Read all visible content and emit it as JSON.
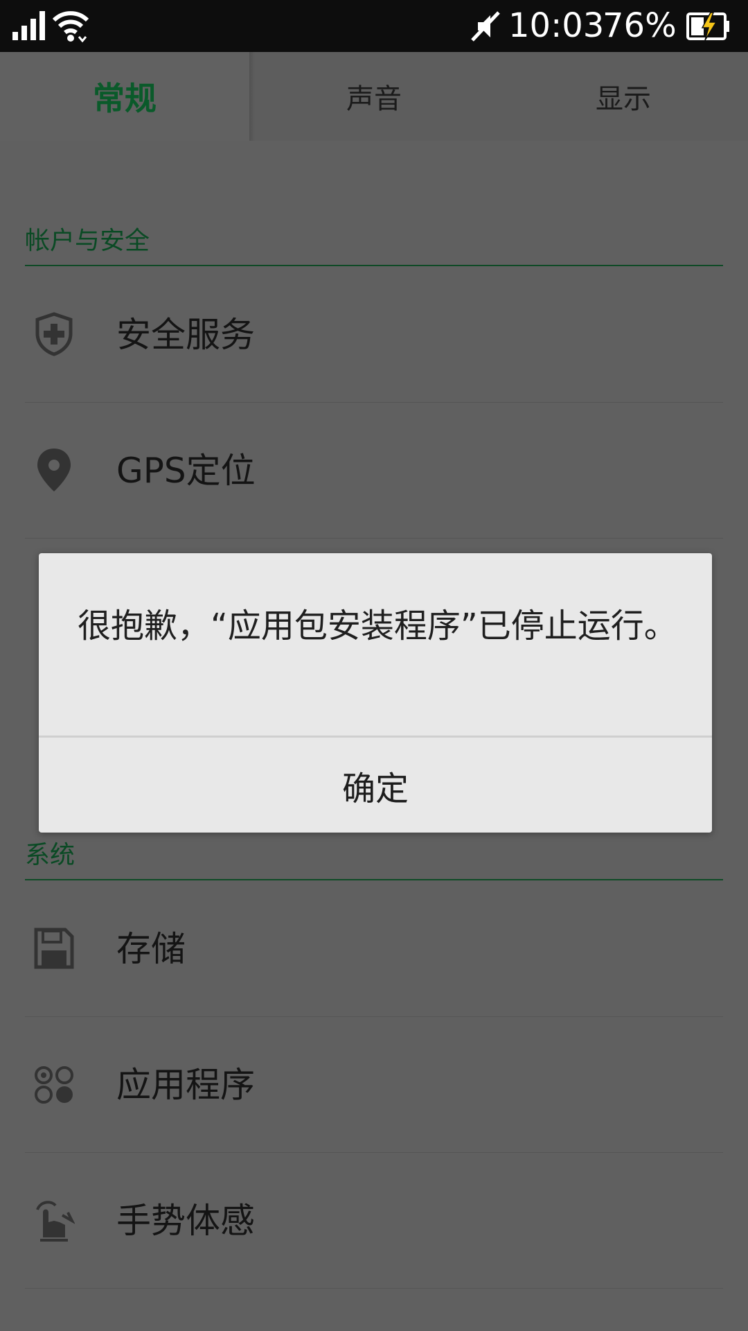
{
  "status_bar": {
    "time": "10:03",
    "battery_percent": "76%",
    "icons": [
      "signal-icon",
      "wifi-icon",
      "mute-icon",
      "battery-charging-icon"
    ],
    "accent_bolt_color": "#f5c518"
  },
  "tabs": [
    {
      "label": "常规",
      "active": true
    },
    {
      "label": "声音",
      "active": false
    },
    {
      "label": "显示",
      "active": false
    }
  ],
  "sections": {
    "account": {
      "title": "帐户与安全",
      "items": [
        {
          "label": "安全服务",
          "icon": "shield-plus-icon"
        },
        {
          "label": "GPS定位",
          "icon": "location-pin-icon"
        }
      ]
    },
    "system": {
      "title": "系统",
      "items": [
        {
          "label": "存储",
          "icon": "floppy-disk-icon"
        },
        {
          "label": "应用程序",
          "icon": "apps-circles-icon"
        },
        {
          "label": "手势体感",
          "icon": "gesture-hand-icon"
        }
      ]
    }
  },
  "dialog": {
    "message": "很抱歉，“应用包安装程序”已停止运行。",
    "ok_label": "确定"
  },
  "colors": {
    "accent_green": "#0a5a2a",
    "overlay_bg": "#606060",
    "dialog_bg": "#e8e8e8"
  }
}
